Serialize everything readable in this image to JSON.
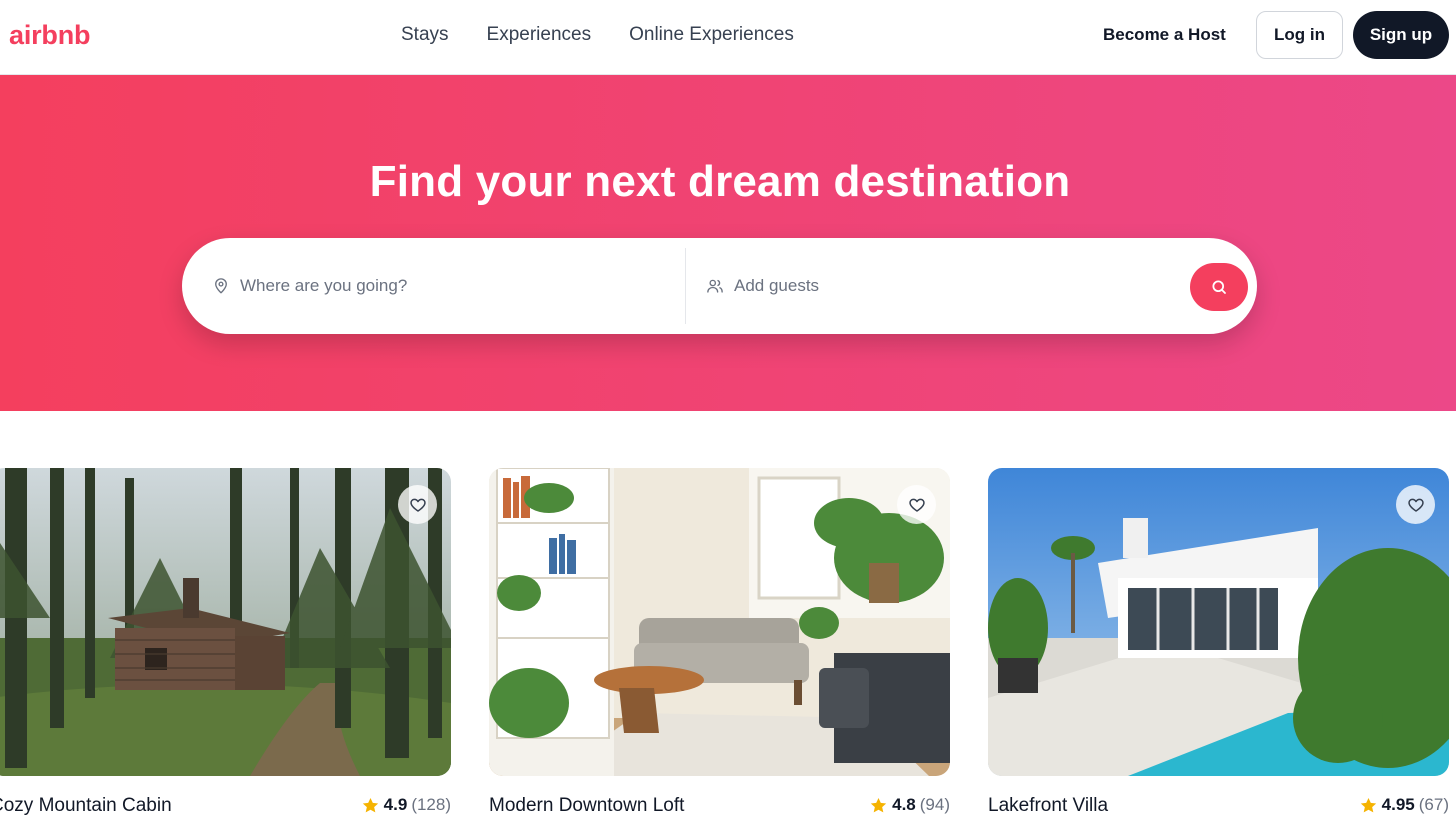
{
  "header": {
    "logo": "airbnb",
    "nav": [
      "Stays",
      "Experiences",
      "Online Experiences"
    ],
    "host_link": "Become a Host",
    "login_label": "Log in",
    "signup_label": "Sign up"
  },
  "hero": {
    "title": "Find your next dream destination",
    "where_placeholder": "Where are you going?",
    "guests_placeholder": "Add guests"
  },
  "listings": [
    {
      "title": "Cozy Mountain Cabin",
      "rating": "4.9",
      "reviews": "(128)"
    },
    {
      "title": "Modern Downtown Loft",
      "rating": "4.8",
      "reviews": "(94)"
    },
    {
      "title": "Lakefront Villa",
      "rating": "4.95",
      "reviews": "(67)"
    }
  ],
  "colors": {
    "brand": "#f43f5e",
    "brand_gradient_end": "#ec4888",
    "dark": "#111827",
    "star": "#f5b301"
  },
  "icons": {
    "where": "map-pin-icon",
    "guests": "users-icon",
    "search": "search-icon",
    "favorite": "heart-icon",
    "rating": "star-icon"
  }
}
